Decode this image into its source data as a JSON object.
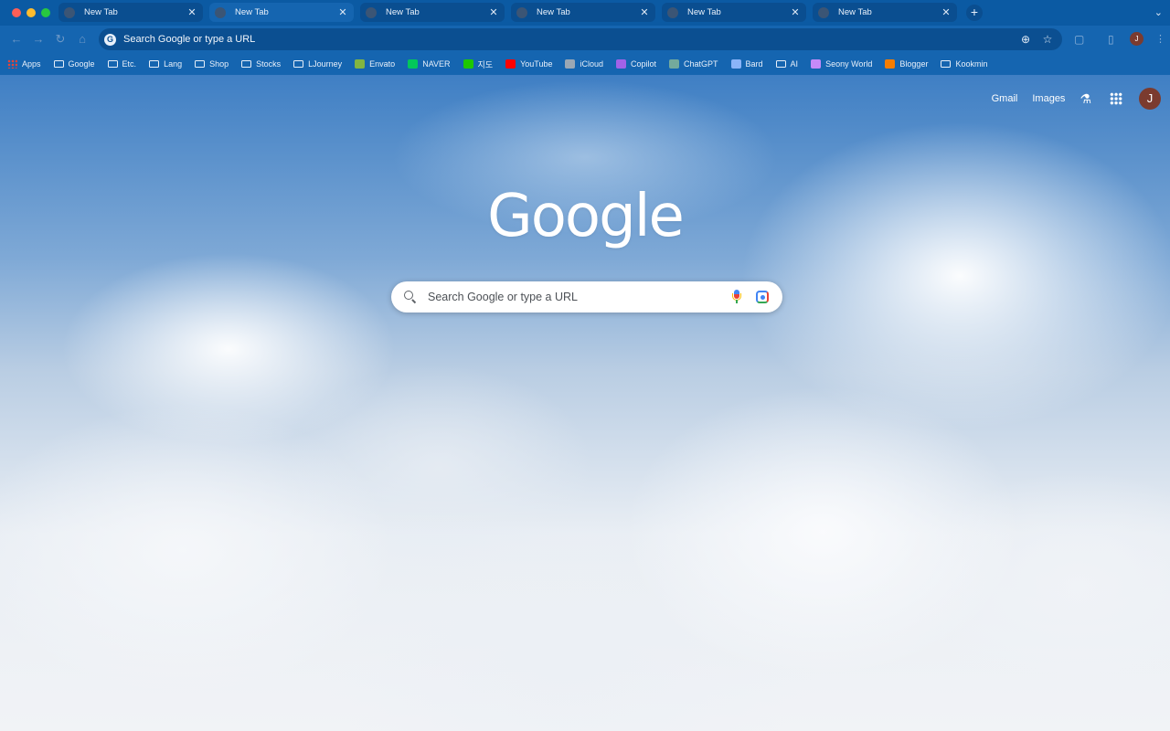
{
  "browser": {
    "tabs": [
      {
        "title": "New Tab",
        "close": "✕",
        "active": false
      },
      {
        "title": "New Tab",
        "close": "✕",
        "active": true
      },
      {
        "title": "New Tab",
        "close": "✕",
        "active": false
      },
      {
        "title": "New Tab",
        "close": "✕",
        "active": false
      },
      {
        "title": "New Tab",
        "close": "✕",
        "active": false
      },
      {
        "title": "New Tab",
        "close": "✕",
        "active": false
      }
    ],
    "new_tab": "+",
    "tab_menu": "⌄",
    "nav": {
      "back": "←",
      "forward": "→",
      "reload": "↻",
      "home": "⌂"
    },
    "omnibox": {
      "placeholder": "Search Google or type a URL",
      "site_icon": "G",
      "zoom_icon": "⊕",
      "star_icon": "☆"
    },
    "toolbar_icons": {
      "extensions": "▢",
      "sidepanel": "▯"
    },
    "profile_initial": "J",
    "menu_icon": "⋮",
    "colors": {
      "frame": "#0b5aa3",
      "toolbar": "#1565b0",
      "omnibox": "#0b4f91"
    }
  },
  "bookmarks": [
    {
      "label": "Apps",
      "icon": "apps-icon"
    },
    {
      "label": "Google",
      "icon": "folder-icon"
    },
    {
      "label": "Etc.",
      "icon": "folder-icon"
    },
    {
      "label": "Lang",
      "icon": "folder-icon"
    },
    {
      "label": "Shop",
      "icon": "folder-icon"
    },
    {
      "label": "Stocks",
      "icon": "folder-icon"
    },
    {
      "label": "LJourney",
      "icon": "folder-icon"
    },
    {
      "label": "Envato",
      "icon": "envato-icon",
      "color": "#82b541"
    },
    {
      "label": "NAVER",
      "icon": "naver-icon",
      "color": "#03c75a"
    },
    {
      "label": "지도",
      "icon": "map-icon",
      "color": "#1ec800"
    },
    {
      "label": "YouTube",
      "icon": "youtube-icon",
      "color": "#ff0000"
    },
    {
      "label": "iCloud",
      "icon": "apple-icon",
      "color": "#9aa7b4"
    },
    {
      "label": "Copilot",
      "icon": "copilot-icon",
      "color": "#a162e8"
    },
    {
      "label": "ChatGPT",
      "icon": "chatgpt-icon",
      "color": "#74aa9c"
    },
    {
      "label": "Bard",
      "icon": "bard-icon",
      "color": "#8ab4f8"
    },
    {
      "label": "AI",
      "icon": "folder-icon"
    },
    {
      "label": "Seony World",
      "icon": "seony-icon",
      "color": "#c58af9"
    },
    {
      "label": "Blogger",
      "icon": "blogger-icon",
      "color": "#f57d00"
    },
    {
      "label": "Kookmin",
      "icon": "folder-icon"
    }
  ],
  "ntp": {
    "gmail": "Gmail",
    "images": "Images",
    "labs_icon": "⚗",
    "avatar_initial": "J",
    "logo": "Google",
    "search_placeholder": "Search Google or type a URL"
  }
}
